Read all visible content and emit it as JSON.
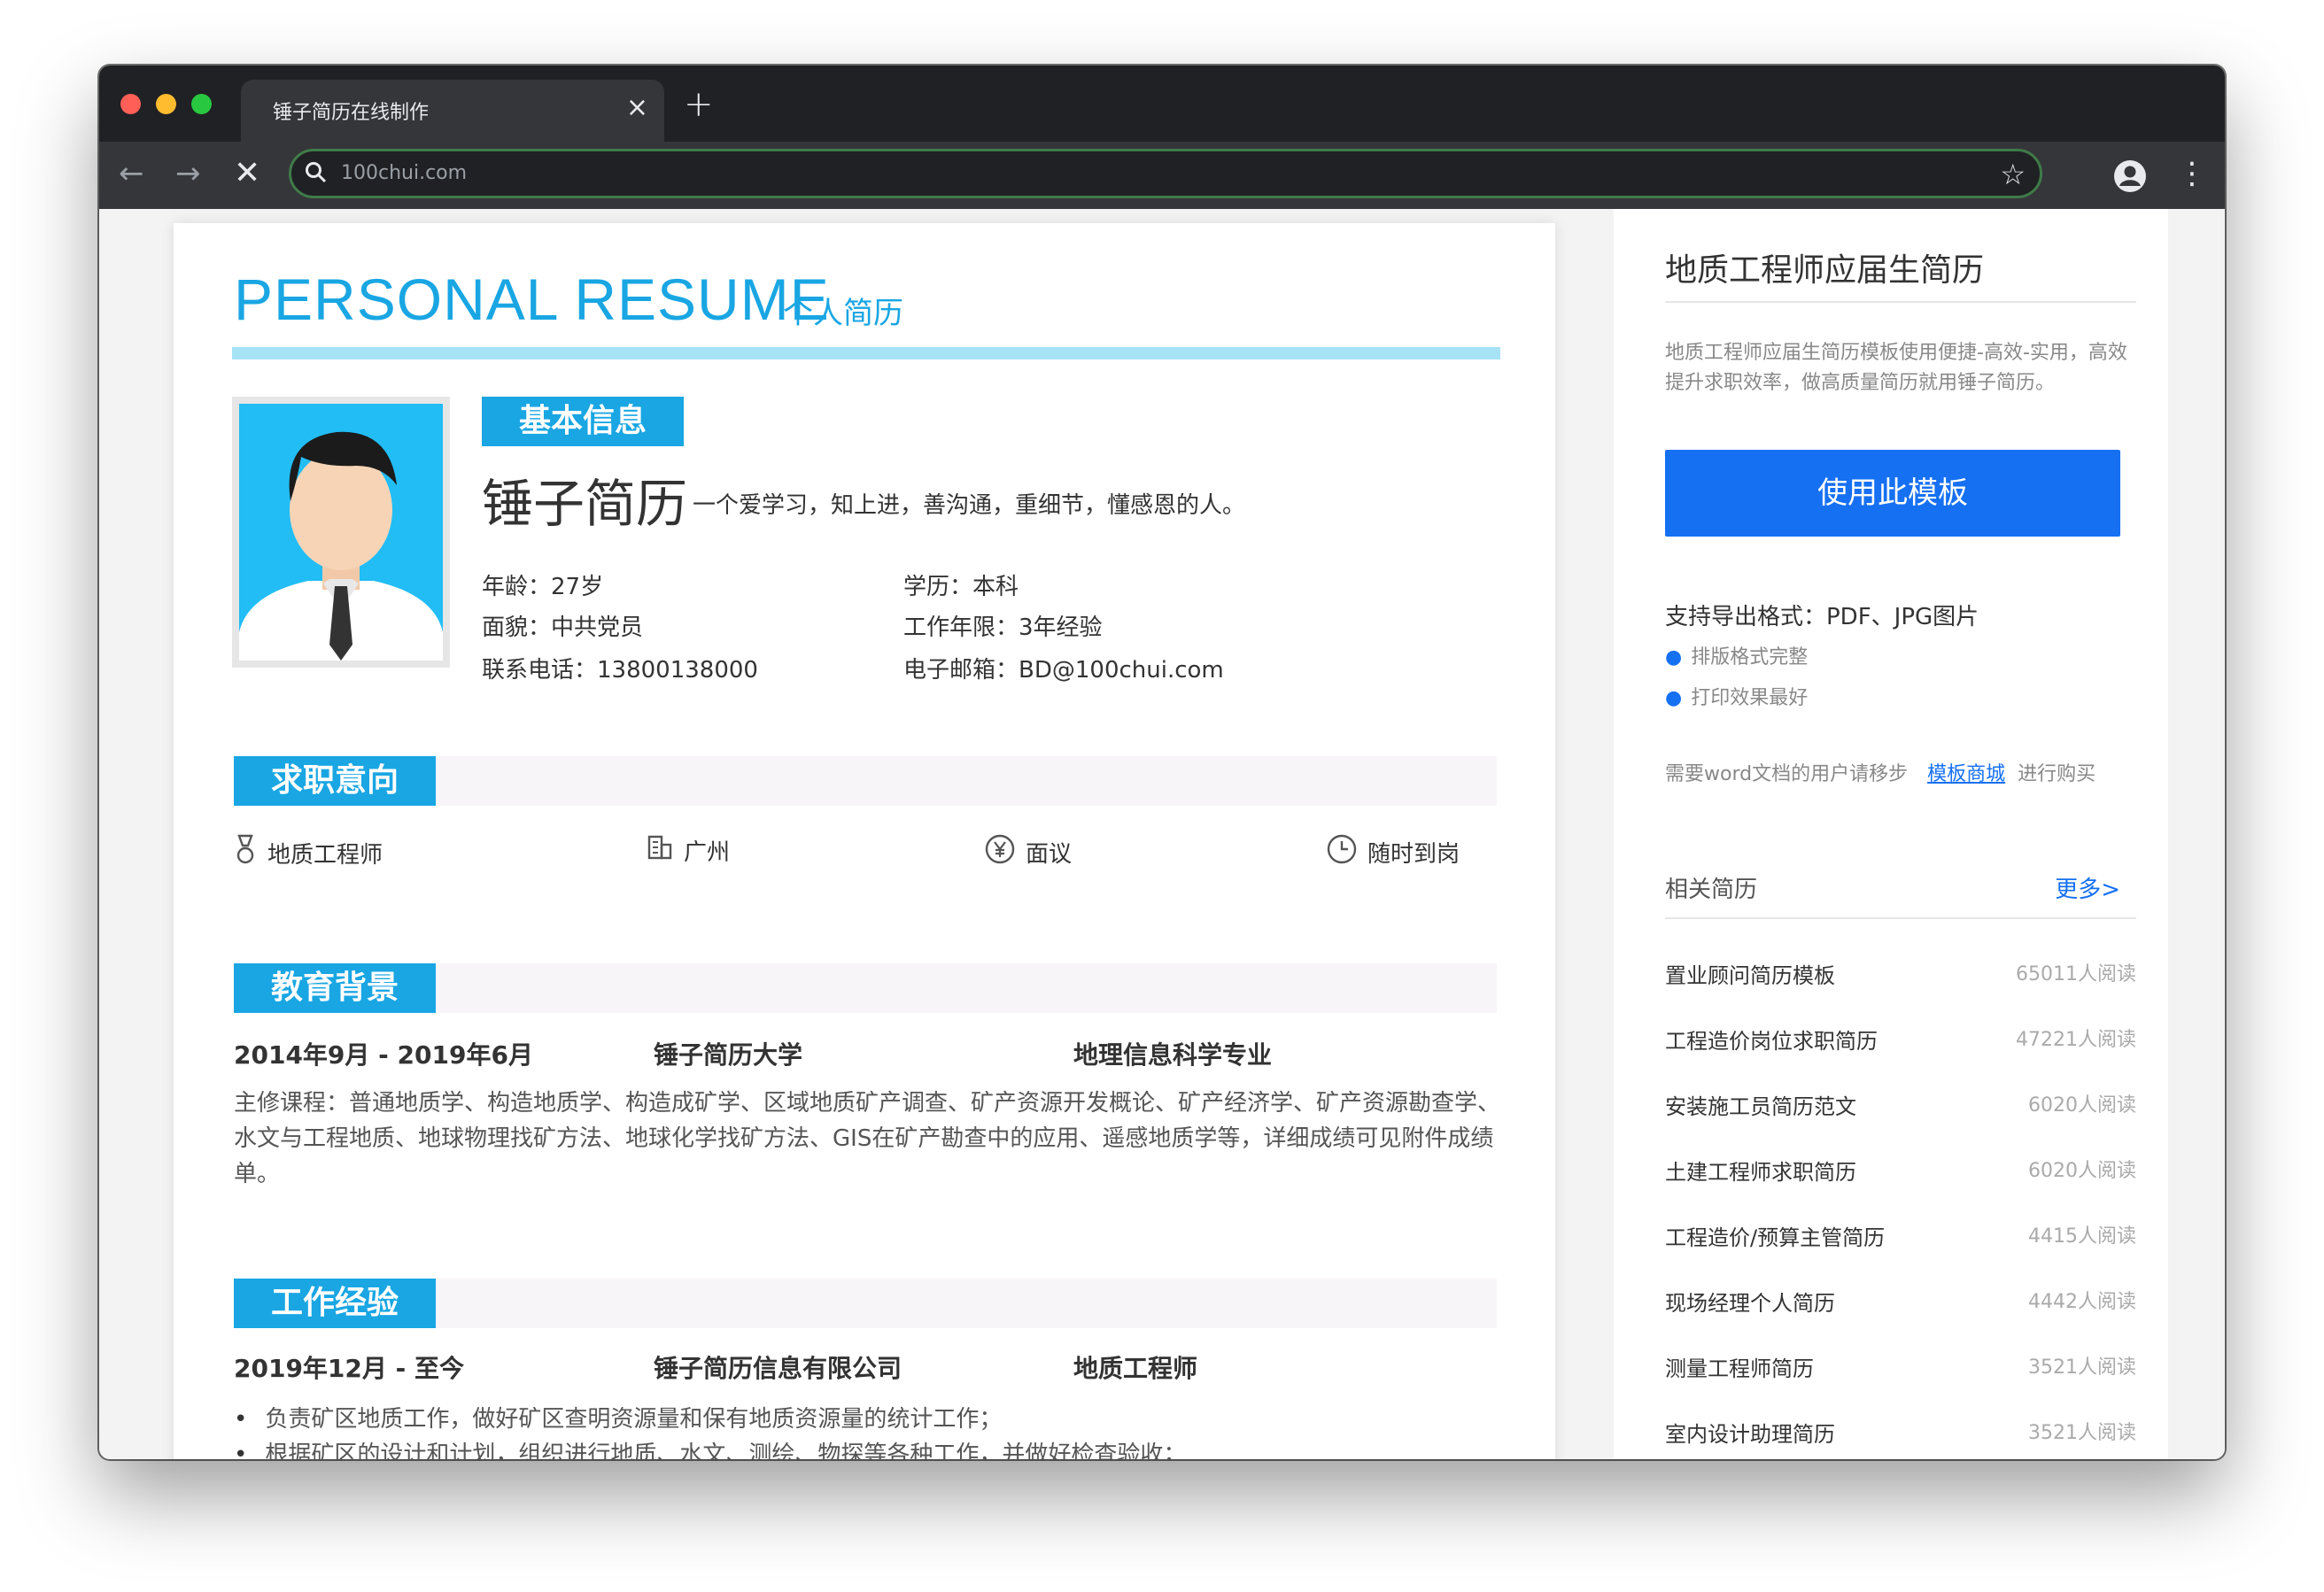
{
  "browser": {
    "tab_title": "锤子简历在线制作",
    "tab_close": "×",
    "new_tab": "+",
    "url": "100chui.com"
  },
  "resume": {
    "title": "PERSONAL RESUME",
    "subtitle": "个人简历",
    "basic": {
      "heading": "基本信息",
      "name": "锤子简历",
      "motto": "一个爱学习，知上进，善沟通，重细节，懂感恩的人。",
      "age": "年龄：27岁",
      "education": "学历：本科",
      "politics": "面貌：中共党员",
      "experience_years": "工作年限：3年经验",
      "phone": "联系电话：13800138000",
      "email": "电子邮箱：BD@100chui.com"
    },
    "intent": {
      "heading": "求职意向",
      "position": "地质工程师",
      "city": "广州",
      "salary": "面议",
      "availability": "随时到岗"
    },
    "education": {
      "heading": "教育背景",
      "period": "2014年9月 - 2019年6月",
      "school": "锤子简历大学",
      "major": "地理信息科学专业",
      "courses": "主修课程：普通地质学、构造地质学、构造成矿学、区域地质矿产调查、矿产资源开发概论、矿产经济学、矿产资源勘查学、水文与工程地质、地球物理找矿方法、地球化学找矿方法、GIS在矿产勘查中的应用、遥感地质学等，详细成绩可见附件成绩单。"
    },
    "work": {
      "heading": "工作经验",
      "period": "2019年12月 - 至今",
      "company": "锤子简历信息有限公司",
      "role": "地质工程师",
      "duties": [
        "负责矿区地质工作，做好矿区查明资源量和保有地质资源量的统计工作；",
        "根据矿区的设计和计划，组织进行地质、水文、测绘、物探等各种工作，并做好检查验收；"
      ]
    }
  },
  "sidebar": {
    "title": "地质工程师应届生简历",
    "description": "地质工程师应届生简历模板使用便捷-高效-实用，高效提升求职效率，做高质量简历就用锤子简历。",
    "use_button": "使用此模板",
    "formats": "支持导出格式：PDF、JPG图片",
    "bullet1": "排版格式完整",
    "bullet2": "打印效果最好",
    "word_prefix": "需要word文档的用户请移步",
    "word_link": "模板商城",
    "word_suffix": "进行购买",
    "related_title": "相关简历",
    "more": "更多>",
    "related": [
      {
        "name": "置业顾问简历模板",
        "reads": "65011人阅读"
      },
      {
        "name": "工程造价岗位求职简历",
        "reads": "47221人阅读"
      },
      {
        "name": "安装施工员简历范文",
        "reads": "6020人阅读"
      },
      {
        "name": "土建工程师求职简历",
        "reads": "6020人阅读"
      },
      {
        "name": "工程造价/预算主管简历",
        "reads": "4415人阅读"
      },
      {
        "name": "现场经理个人简历",
        "reads": "4442人阅读"
      },
      {
        "name": "测量工程师简历",
        "reads": "3521人阅读"
      },
      {
        "name": "室内设计助理简历",
        "reads": "3521人阅读"
      }
    ]
  },
  "colors": {
    "accent": "#19a6e3",
    "button": "#1670f2",
    "browser_dark": "#202124",
    "browser_toolbar": "#35363a"
  },
  "icons": [
    "search-icon",
    "star-icon",
    "profile-icon",
    "medal-icon",
    "building-icon",
    "yen-icon",
    "clock-icon"
  ]
}
